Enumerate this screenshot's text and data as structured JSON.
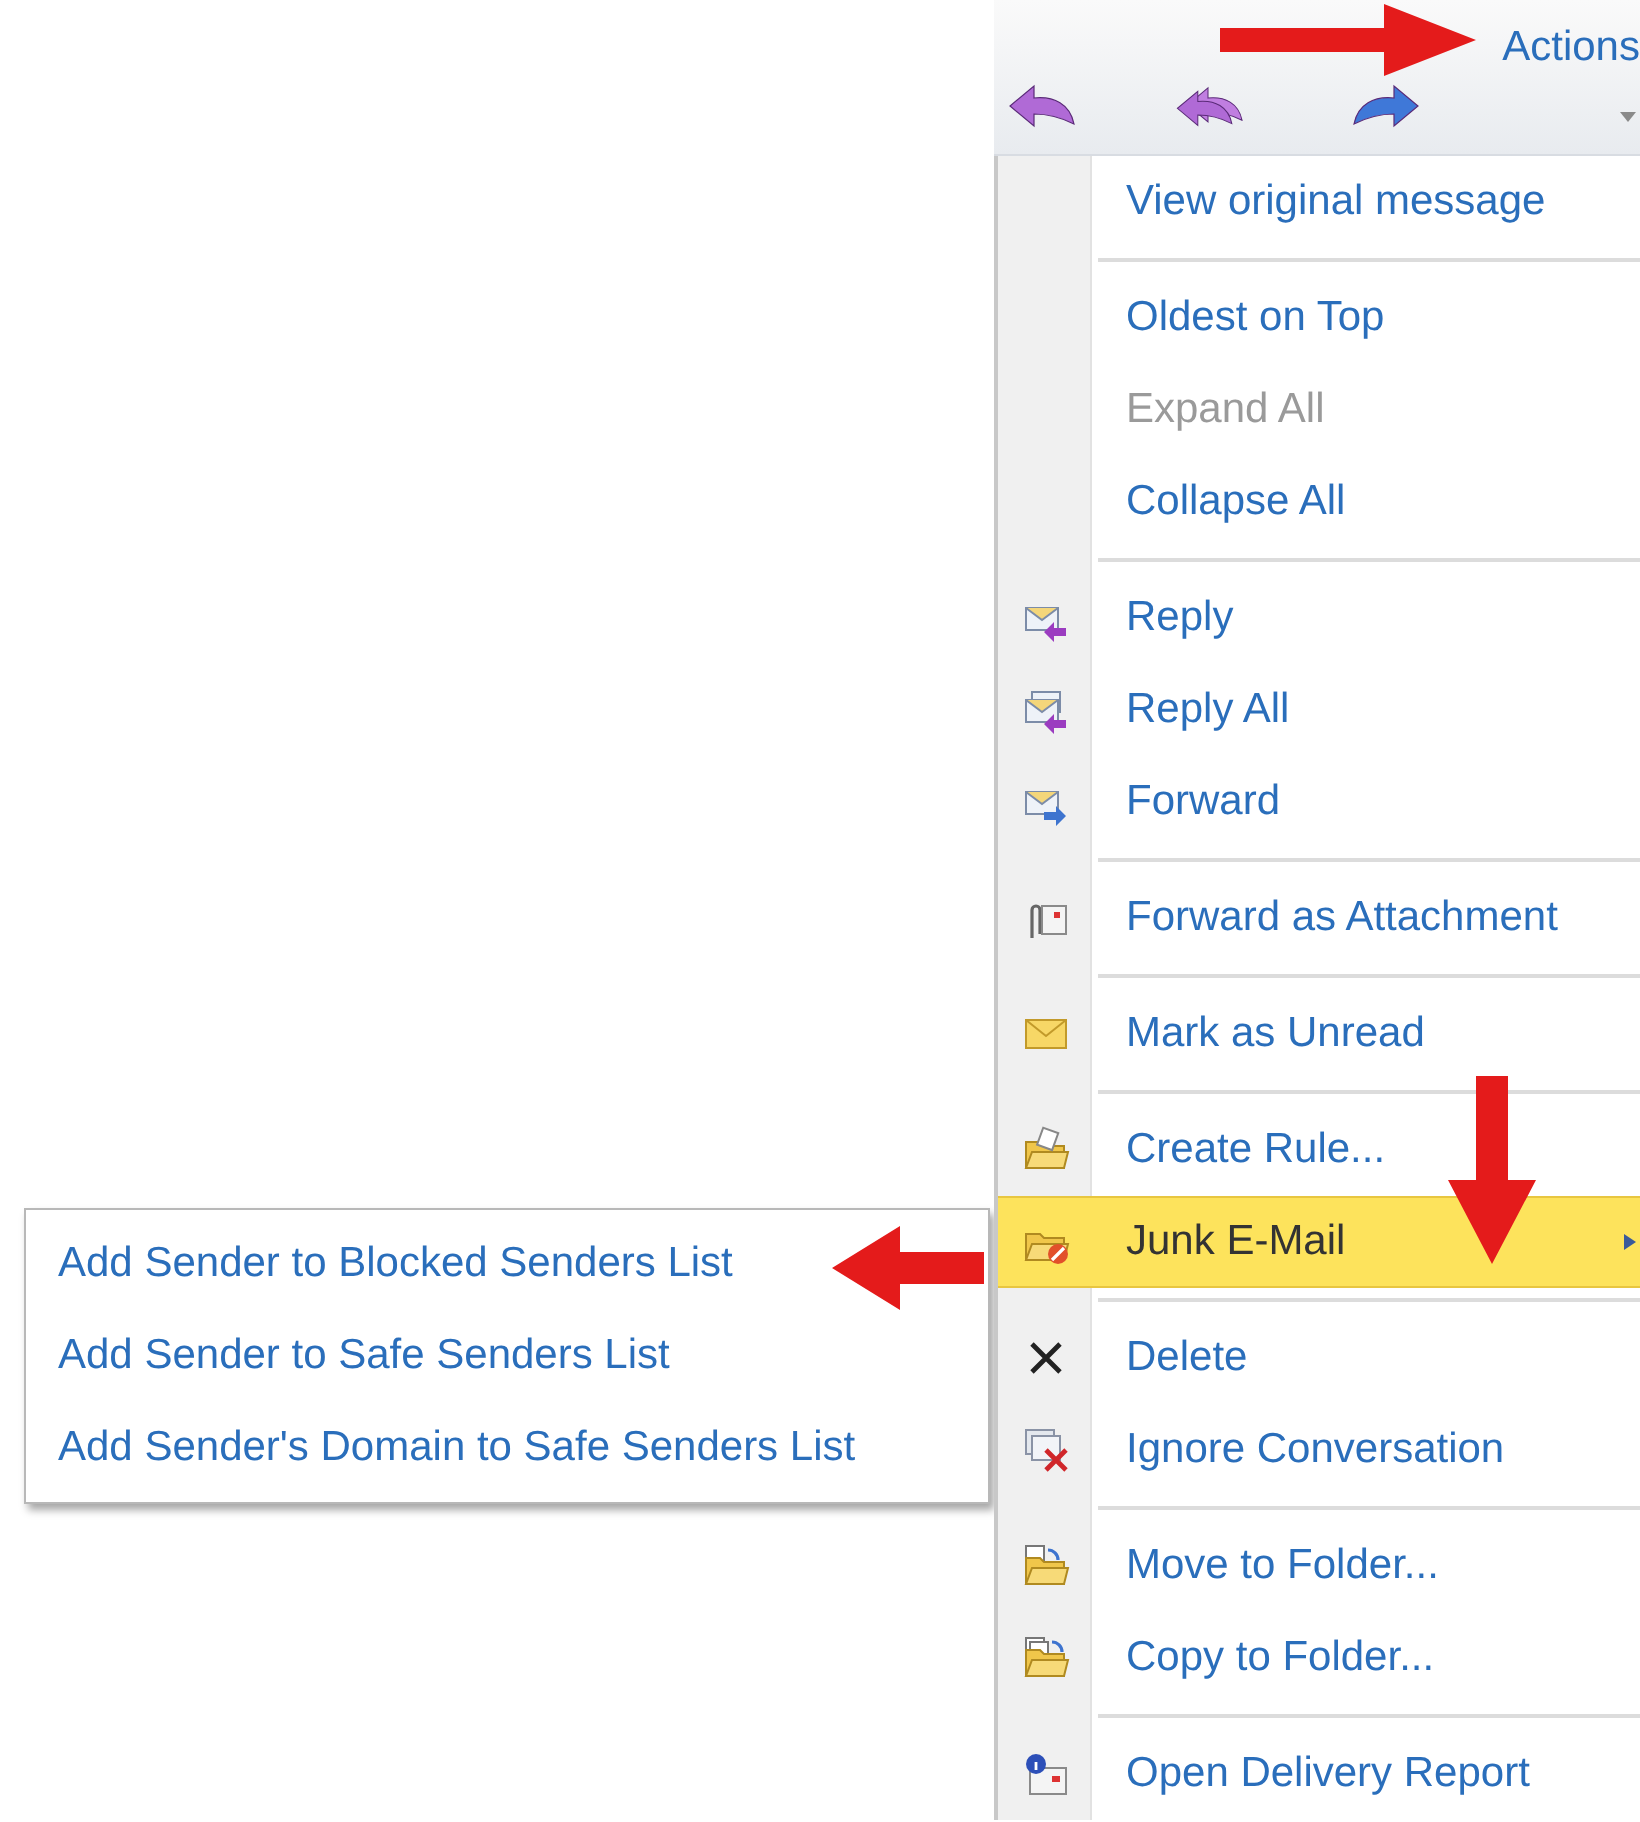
{
  "header": {
    "title": "Actions"
  },
  "menu": {
    "items": [
      {
        "kind": "item",
        "label": "View original message",
        "disabled": false,
        "selected": false
      },
      {
        "kind": "separator"
      },
      {
        "kind": "item",
        "label": "Oldest on Top",
        "disabled": false,
        "selected": false
      },
      {
        "kind": "item",
        "label": "Expand All",
        "disabled": true,
        "selected": false
      },
      {
        "kind": "item",
        "label": "Collapse All",
        "disabled": false,
        "selected": false
      },
      {
        "kind": "separator"
      },
      {
        "kind": "item",
        "label": "Reply",
        "disabled": false,
        "selected": false
      },
      {
        "kind": "item",
        "label": "Reply All",
        "disabled": false,
        "selected": false
      },
      {
        "kind": "item",
        "label": "Forward",
        "disabled": false,
        "selected": false
      },
      {
        "kind": "separator"
      },
      {
        "kind": "item",
        "label": "Forward as Attachment",
        "disabled": false,
        "selected": false
      },
      {
        "kind": "separator"
      },
      {
        "kind": "item",
        "label": "Mark as Unread",
        "disabled": false,
        "selected": false
      },
      {
        "kind": "separator"
      },
      {
        "kind": "item",
        "label": "Create Rule...",
        "disabled": false,
        "selected": false
      },
      {
        "kind": "item",
        "label": "Junk E-Mail",
        "disabled": false,
        "selected": true,
        "submenu": [
          {
            "label": "Add Sender to Blocked Senders List"
          },
          {
            "label": "Add Sender to Safe Senders List"
          },
          {
            "label": "Add Sender's Domain to Safe Senders List"
          }
        ]
      },
      {
        "kind": "separator"
      },
      {
        "kind": "item",
        "label": "Delete",
        "disabled": false,
        "selected": false
      },
      {
        "kind": "item",
        "label": "Ignore Conversation",
        "disabled": false,
        "selected": false
      },
      {
        "kind": "separator"
      },
      {
        "kind": "item",
        "label": "Move to Folder...",
        "disabled": false,
        "selected": false
      },
      {
        "kind": "item",
        "label": "Copy to Folder...",
        "disabled": false,
        "selected": false
      },
      {
        "kind": "separator"
      },
      {
        "kind": "item",
        "label": "Open Delivery Report",
        "disabled": false,
        "selected": false
      }
    ]
  }
}
